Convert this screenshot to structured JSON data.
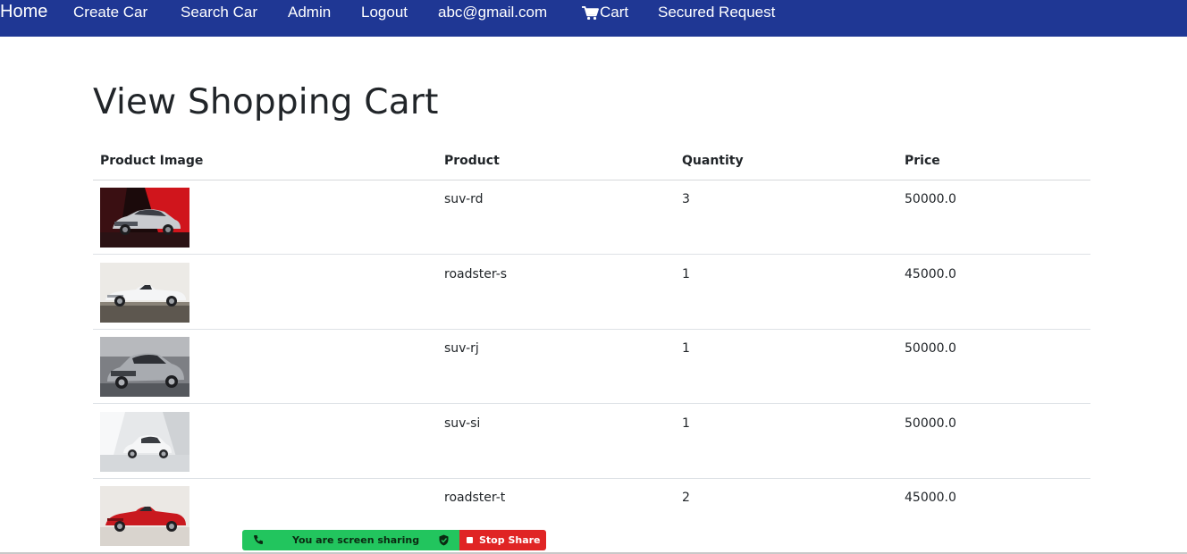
{
  "nav": {
    "brand": "Home",
    "items": [
      "Create Car",
      "Search Car",
      "Admin",
      "Logout",
      "abc@gmail.com",
      "Cart",
      "Secured Request"
    ]
  },
  "page": {
    "title": "View Shopping Cart"
  },
  "table": {
    "headers": [
      "Product Image",
      "Product",
      "Quantity",
      "Price"
    ],
    "rows": [
      {
        "image": "car-image",
        "product": "suv-rd",
        "quantity": "3",
        "price": "50000.0"
      },
      {
        "image": "car-image",
        "product": "roadster-s",
        "quantity": "1",
        "price": "45000.0"
      },
      {
        "image": "car-image",
        "product": "suv-rj",
        "quantity": "1",
        "price": "50000.0"
      },
      {
        "image": "car-image",
        "product": "suv-si",
        "quantity": "1",
        "price": "50000.0"
      },
      {
        "image": "car-image",
        "product": "roadster-t",
        "quantity": "2",
        "price": "45000.0"
      }
    ]
  },
  "share_bar": {
    "status": "You are screen sharing",
    "stop_label": "Stop Share"
  },
  "colors": {
    "navbar": "#1f3794",
    "share_green": "#22c55e",
    "share_red": "#e02424"
  },
  "icons": {
    "cart": "cart-icon",
    "phone": "phone-icon",
    "shield": "shield-icon",
    "stop": "stop-icon"
  }
}
